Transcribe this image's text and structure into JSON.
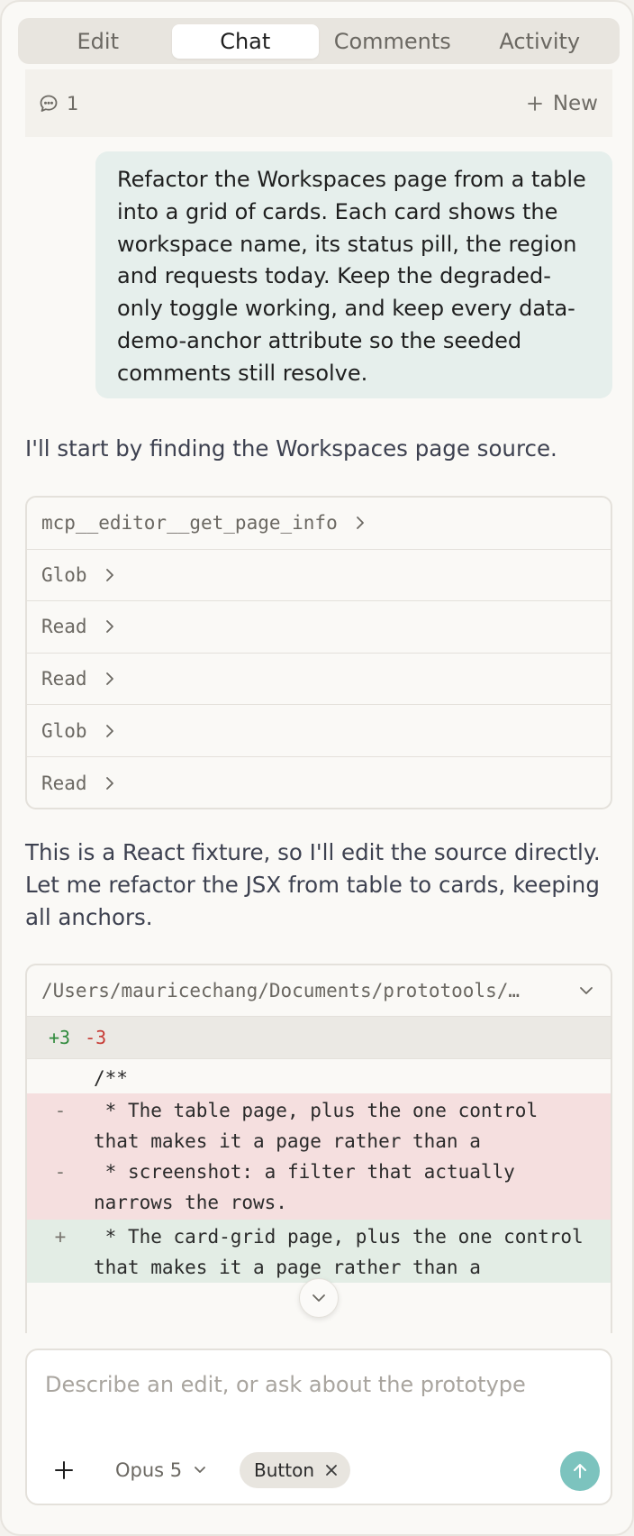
{
  "tabs": [
    {
      "label": "Edit",
      "active": false
    },
    {
      "label": "Chat",
      "active": true
    },
    {
      "label": "Comments",
      "active": false
    },
    {
      "label": "Activity",
      "active": false
    }
  ],
  "thread": {
    "comment_count": "1",
    "new_label": "New"
  },
  "messages": {
    "user_prompt": "Refactor the Workspaces page from a table into a grid of cards. Each card shows the workspace name, its status pill, the region and requests today. Keep the degraded-only toggle working, and keep every data-demo-anchor attribute so the seeded comments still resolve.",
    "assistant_1": "I'll start by finding the Workspaces page source.",
    "assistant_2": "This is a React fixture, so I'll edit the source directly. Let me refactor the JSX from table to cards, keeping all anchors."
  },
  "tools": [
    "mcp__editor__get_page_info",
    "Glob",
    "Read",
    "Read",
    "Glob",
    "Read"
  ],
  "diff": {
    "path": "/Users/mauricechang/Documents/prototools/…",
    "added": "+3",
    "removed": "-3",
    "lines": [
      {
        "type": "ctx",
        "sign": "",
        "code": "/**"
      },
      {
        "type": "del",
        "sign": "-",
        "code": " * The table page, plus the one control that makes it a page rather than a"
      },
      {
        "type": "del",
        "sign": "-",
        "code": " * screenshot: a filter that actually narrows the rows."
      },
      {
        "type": "add",
        "sign": "+",
        "code": " * The card-grid page, plus the one control that makes it a page rather than a"
      }
    ]
  },
  "composer": {
    "placeholder": "Describe an edit, or ask about the prototype",
    "model": "Opus 5",
    "chip_label": "Button"
  },
  "colors": {
    "accent_send": "#7cc3be",
    "user_bubble": "#e6efec",
    "diff_add_bg": "#e3ede5",
    "diff_del_bg": "#f5dfdf",
    "add_text": "#2f8a3c",
    "del_text": "#c73a34"
  },
  "icons": {
    "comment": "speech-bubble-icon",
    "new": "plus-icon",
    "tool_expand": "chevron-right-icon",
    "diff_expand": "chevron-down-icon",
    "scroll": "chevron-down-icon",
    "attach": "plus-icon",
    "model_dropdown": "chevron-down-icon",
    "chip_remove": "close-icon",
    "send": "arrow-up-icon"
  }
}
